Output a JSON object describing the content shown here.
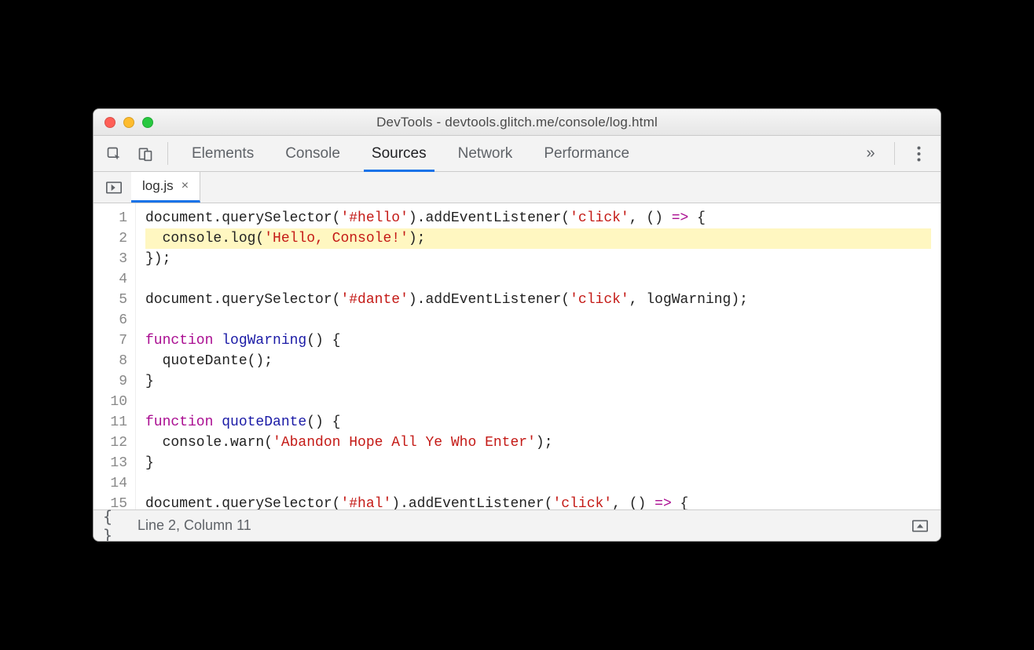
{
  "window": {
    "title": "DevTools - devtools.glitch.me/console/log.html"
  },
  "tabs": {
    "items": [
      "Elements",
      "Console",
      "Sources",
      "Network",
      "Performance"
    ],
    "active_index": 2,
    "overflow_glyph": "»"
  },
  "filebar": {
    "filename": "log.js",
    "close_glyph": "×"
  },
  "editor": {
    "highlight_line": 2,
    "lines": [
      {
        "n": 1,
        "t": [
          [
            "",
            "document.querySelector("
          ],
          [
            "str",
            "'#hello'"
          ],
          [
            "",
            ").addEventListener("
          ],
          [
            "str",
            "'click'"
          ],
          [
            "",
            ", () "
          ],
          [
            "kw",
            "=>"
          ],
          [
            "",
            " {"
          ]
        ]
      },
      {
        "n": 2,
        "t": [
          [
            "",
            "  console.log("
          ],
          [
            "str",
            "'Hello, Console!'"
          ],
          [
            "",
            ");"
          ]
        ]
      },
      {
        "n": 3,
        "t": [
          [
            "",
            "});"
          ]
        ]
      },
      {
        "n": 4,
        "t": [
          [
            "",
            ""
          ]
        ]
      },
      {
        "n": 5,
        "t": [
          [
            "",
            "document.querySelector("
          ],
          [
            "str",
            "'#dante'"
          ],
          [
            "",
            ").addEventListener("
          ],
          [
            "str",
            "'click'"
          ],
          [
            "",
            ", logWarning);"
          ]
        ]
      },
      {
        "n": 6,
        "t": [
          [
            "",
            ""
          ]
        ]
      },
      {
        "n": 7,
        "t": [
          [
            "kw",
            "function "
          ],
          [
            "fn",
            "logWarning"
          ],
          [
            "",
            "() {"
          ]
        ]
      },
      {
        "n": 8,
        "t": [
          [
            "",
            "  quoteDante();"
          ]
        ]
      },
      {
        "n": 9,
        "t": [
          [
            "",
            "}"
          ]
        ]
      },
      {
        "n": 10,
        "t": [
          [
            "",
            ""
          ]
        ]
      },
      {
        "n": 11,
        "t": [
          [
            "kw",
            "function "
          ],
          [
            "fn",
            "quoteDante"
          ],
          [
            "",
            "() {"
          ]
        ]
      },
      {
        "n": 12,
        "t": [
          [
            "",
            "  console.warn("
          ],
          [
            "str",
            "'Abandon Hope All Ye Who Enter'"
          ],
          [
            "",
            ");"
          ]
        ]
      },
      {
        "n": 13,
        "t": [
          [
            "",
            "}"
          ]
        ]
      },
      {
        "n": 14,
        "t": [
          [
            "",
            ""
          ]
        ]
      },
      {
        "n": 15,
        "t": [
          [
            "",
            "document.querySelector("
          ],
          [
            "str",
            "'#hal'"
          ],
          [
            "",
            ").addEventListener("
          ],
          [
            "str",
            "'click'"
          ],
          [
            "",
            ", () "
          ],
          [
            "kw",
            "=>"
          ],
          [
            "",
            " {"
          ]
        ]
      }
    ]
  },
  "status": {
    "text": "Line 2, Column 11"
  }
}
